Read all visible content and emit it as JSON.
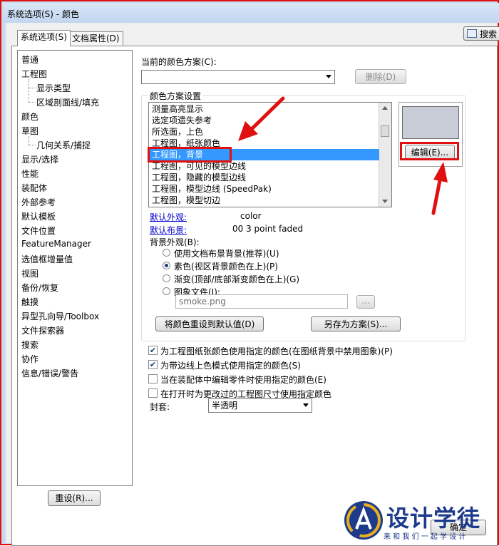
{
  "window": {
    "title": "系统选项(S) - 颜色"
  },
  "tabs": [
    {
      "label": "系统选项(S)"
    },
    {
      "label": "文档属性(D)"
    }
  ],
  "search": {
    "label": "搜索"
  },
  "tree": [
    {
      "label": "普通"
    },
    {
      "label": "工程图"
    },
    {
      "label": "显示类型"
    },
    {
      "label": "区域剖面线/填充"
    },
    {
      "label": "颜色"
    },
    {
      "label": "草图"
    },
    {
      "label": "几何关系/捕捉"
    },
    {
      "label": "显示/选择"
    },
    {
      "label": "性能"
    },
    {
      "label": "装配体"
    },
    {
      "label": "外部参考"
    },
    {
      "label": "默认模板"
    },
    {
      "label": "文件位置"
    },
    {
      "label": "FeatureManager"
    },
    {
      "label": "选值框增量值"
    },
    {
      "label": "视图"
    },
    {
      "label": "备份/恢复"
    },
    {
      "label": "触摸"
    },
    {
      "label": "异型孔向导/Toolbox"
    },
    {
      "label": "文件探索器"
    },
    {
      "label": "搜索"
    },
    {
      "label": "协作"
    },
    {
      "label": "信息/错误/警告"
    }
  ],
  "reset_button": {
    "label": "重设(R)..."
  },
  "scheme": {
    "label": "当前的颜色方案(C):",
    "value": "",
    "delete_label": "删除(D)"
  },
  "settings": {
    "group_label": "颜色方案设置",
    "items": [
      {
        "label": "测量高亮显示"
      },
      {
        "label": "选定项遗失参考"
      },
      {
        "label": "所选面，上色"
      },
      {
        "label": "工程图，纸张颜色"
      },
      {
        "label": "工程图，背景"
      },
      {
        "label": "工程图，可见的模型边线"
      },
      {
        "label": "工程图，隐藏的模型边线"
      },
      {
        "label": "工程图，模型边线 (SpeedPak)"
      },
      {
        "label": "工程图，模型切边"
      }
    ],
    "selected_index": 4,
    "swatch_color": "#c9cdd8",
    "edit_label": "编辑(E)...",
    "default_appearance_label": "默认外观:",
    "default_appearance_value": "color",
    "default_scene_label": "默认布景:",
    "default_scene_value": "00 3 point faded",
    "bg_label": "背景外观(B):",
    "bg_options": [
      {
        "label": "使用文档布景背景(推荐)(U)",
        "checked": false
      },
      {
        "label": "素色(视区背景颜色在上)(P)",
        "checked": true
      },
      {
        "label": "渐变(顶部/底部渐变颜色在上)(G)",
        "checked": false
      },
      {
        "label": "图象文件(I):",
        "checked": false
      }
    ],
    "image_file": "smoke.png",
    "browse_label": "...",
    "reset_colors_label": "将颜色重设到默认值(D)",
    "save_scheme_label": "另存为方案(S)..."
  },
  "checks": [
    {
      "label": "为工程图纸张颜色使用指定的颜色(在图纸背景中禁用图象)(P)",
      "checked": true
    },
    {
      "label": "为带边线上色模式使用指定的颜色(S)",
      "checked": true
    },
    {
      "label": "当在装配体中编辑零件时使用指定的颜色(E)",
      "checked": false
    },
    {
      "label": "在打开时为更改过的工程图尺寸使用指定颜色",
      "checked": false
    }
  ],
  "envelope": {
    "label": "封套:",
    "value": "半透明"
  },
  "footer": {
    "ok_label": "确定"
  },
  "watermark": {
    "name": "设计学徒",
    "slogan": "来 和 我 们 一 起 学 设 计"
  },
  "colors": {
    "annotation": "#e01010",
    "selection": "#3399ff"
  }
}
